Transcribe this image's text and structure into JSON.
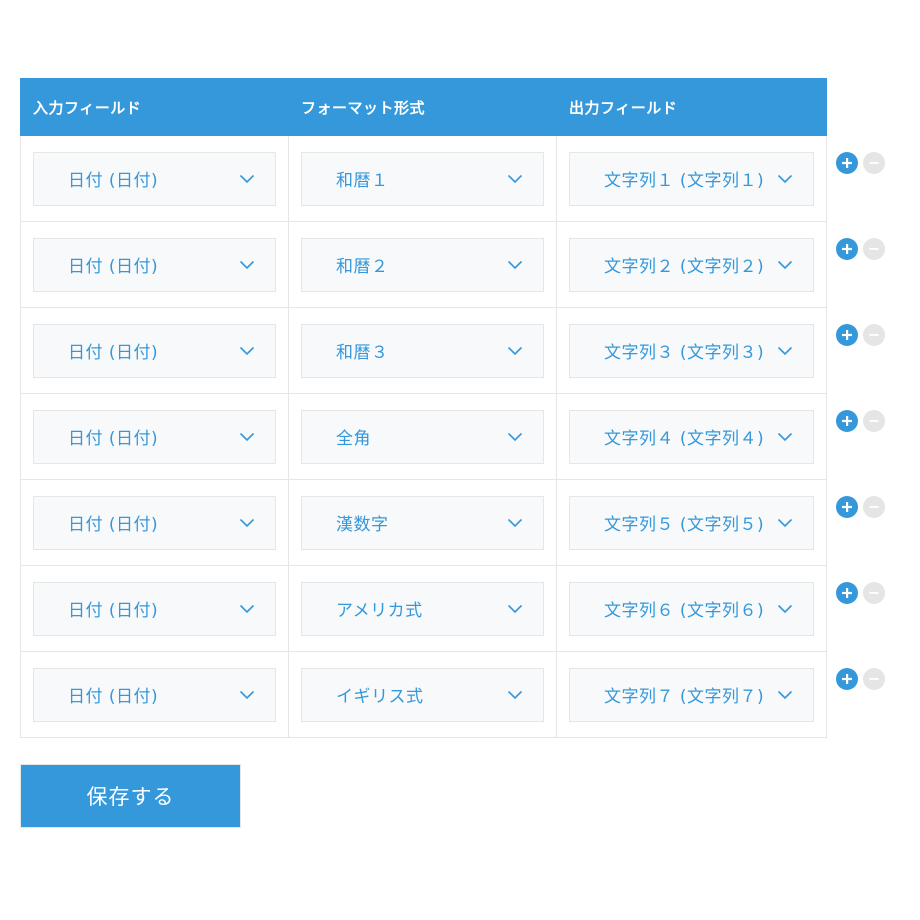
{
  "table": {
    "headers": [
      "入力フィールド",
      "フォーマット形式",
      "出力フィールド"
    ],
    "rows": [
      {
        "input": "日付 (日付)",
        "format": "和暦１",
        "output": "文字列１ (文字列１)"
      },
      {
        "input": "日付 (日付)",
        "format": "和暦２",
        "output": "文字列２ (文字列２)"
      },
      {
        "input": "日付 (日付)",
        "format": "和暦３",
        "output": "文字列３ (文字列３)"
      },
      {
        "input": "日付 (日付)",
        "format": "全角",
        "output": "文字列４ (文字列４)"
      },
      {
        "input": "日付 (日付)",
        "format": "漢数字",
        "output": "文字列５ (文字列５)"
      },
      {
        "input": "日付 (日付)",
        "format": "アメリカ式",
        "output": "文字列６ (文字列６)"
      },
      {
        "input": "日付 (日付)",
        "format": "イギリス式",
        "output": "文字列７ (文字列７)"
      }
    ]
  },
  "icons": {
    "dropdown": "chevron-down-icon",
    "add_row": "plus-circle-icon",
    "remove_row": "minus-circle-icon"
  },
  "save_label": "保存する",
  "colors": {
    "accent": "#3498db",
    "cell_border": "#e3e7e8",
    "field_bg": "#f7f9fa",
    "remove_button_bg": "#e5e5e5"
  }
}
